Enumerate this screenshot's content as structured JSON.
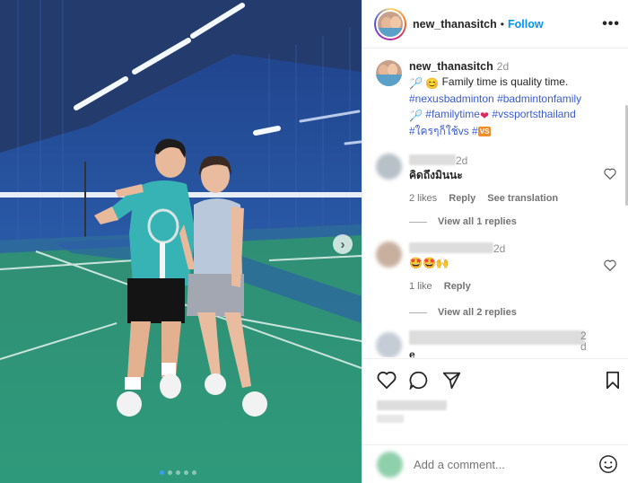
{
  "post": {
    "username": "new_thanasitch",
    "follow_label": "Follow",
    "more_label": "•••",
    "caption_time": "2d",
    "caption_line1": "Family time is quality time.",
    "caption_tags1": "#nexusbadminton #badmintonfamily",
    "caption_tags2a": "#familytime",
    "caption_tags2b": "#vssportsthailand",
    "caption_tags3": "#ใครๆก็ใช้vs #",
    "vs_badge": "VS"
  },
  "comments": [
    {
      "time": "2d",
      "text": "คิดถึงมินนะ",
      "likes": "2 likes",
      "reply": "Reply",
      "translate": "See translation",
      "view_replies": "View all 1 replies"
    },
    {
      "time": "2d",
      "text": "🤩🤩🙌",
      "likes": "1 like",
      "reply": "Reply",
      "view_replies": "View all 2 replies"
    },
    {
      "time_a": "2",
      "time_b": "d",
      "text": "e"
    }
  ],
  "add_comment": {
    "placeholder": "Add a comment..."
  },
  "icons": {
    "next": "chevron-right-icon",
    "like": "heart-icon",
    "comment": "comment-icon",
    "share": "paper-plane-icon",
    "save": "bookmark-icon",
    "emoji": "smile-icon"
  },
  "colors": {
    "link": "#0095f6",
    "tag": "#3b5bdb",
    "court": "#2a7a63"
  },
  "carousel": {
    "count": 5,
    "active": 0
  }
}
